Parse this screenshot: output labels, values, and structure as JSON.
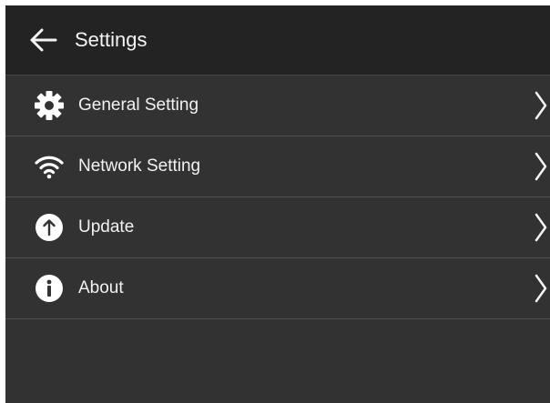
{
  "header": {
    "title": "Settings",
    "back_icon": "arrow-left-icon"
  },
  "menu": {
    "items": [
      {
        "label": "General Setting",
        "icon": "gear-icon"
      },
      {
        "label": "Network Setting",
        "icon": "wifi-icon"
      },
      {
        "label": "Update",
        "icon": "arrow-up-circle-icon"
      },
      {
        "label": "About",
        "icon": "info-circle-icon"
      }
    ]
  },
  "colors": {
    "background": "#323232",
    "header_background": "#232323",
    "divider": "#505050",
    "text": "#f2f2f2"
  }
}
